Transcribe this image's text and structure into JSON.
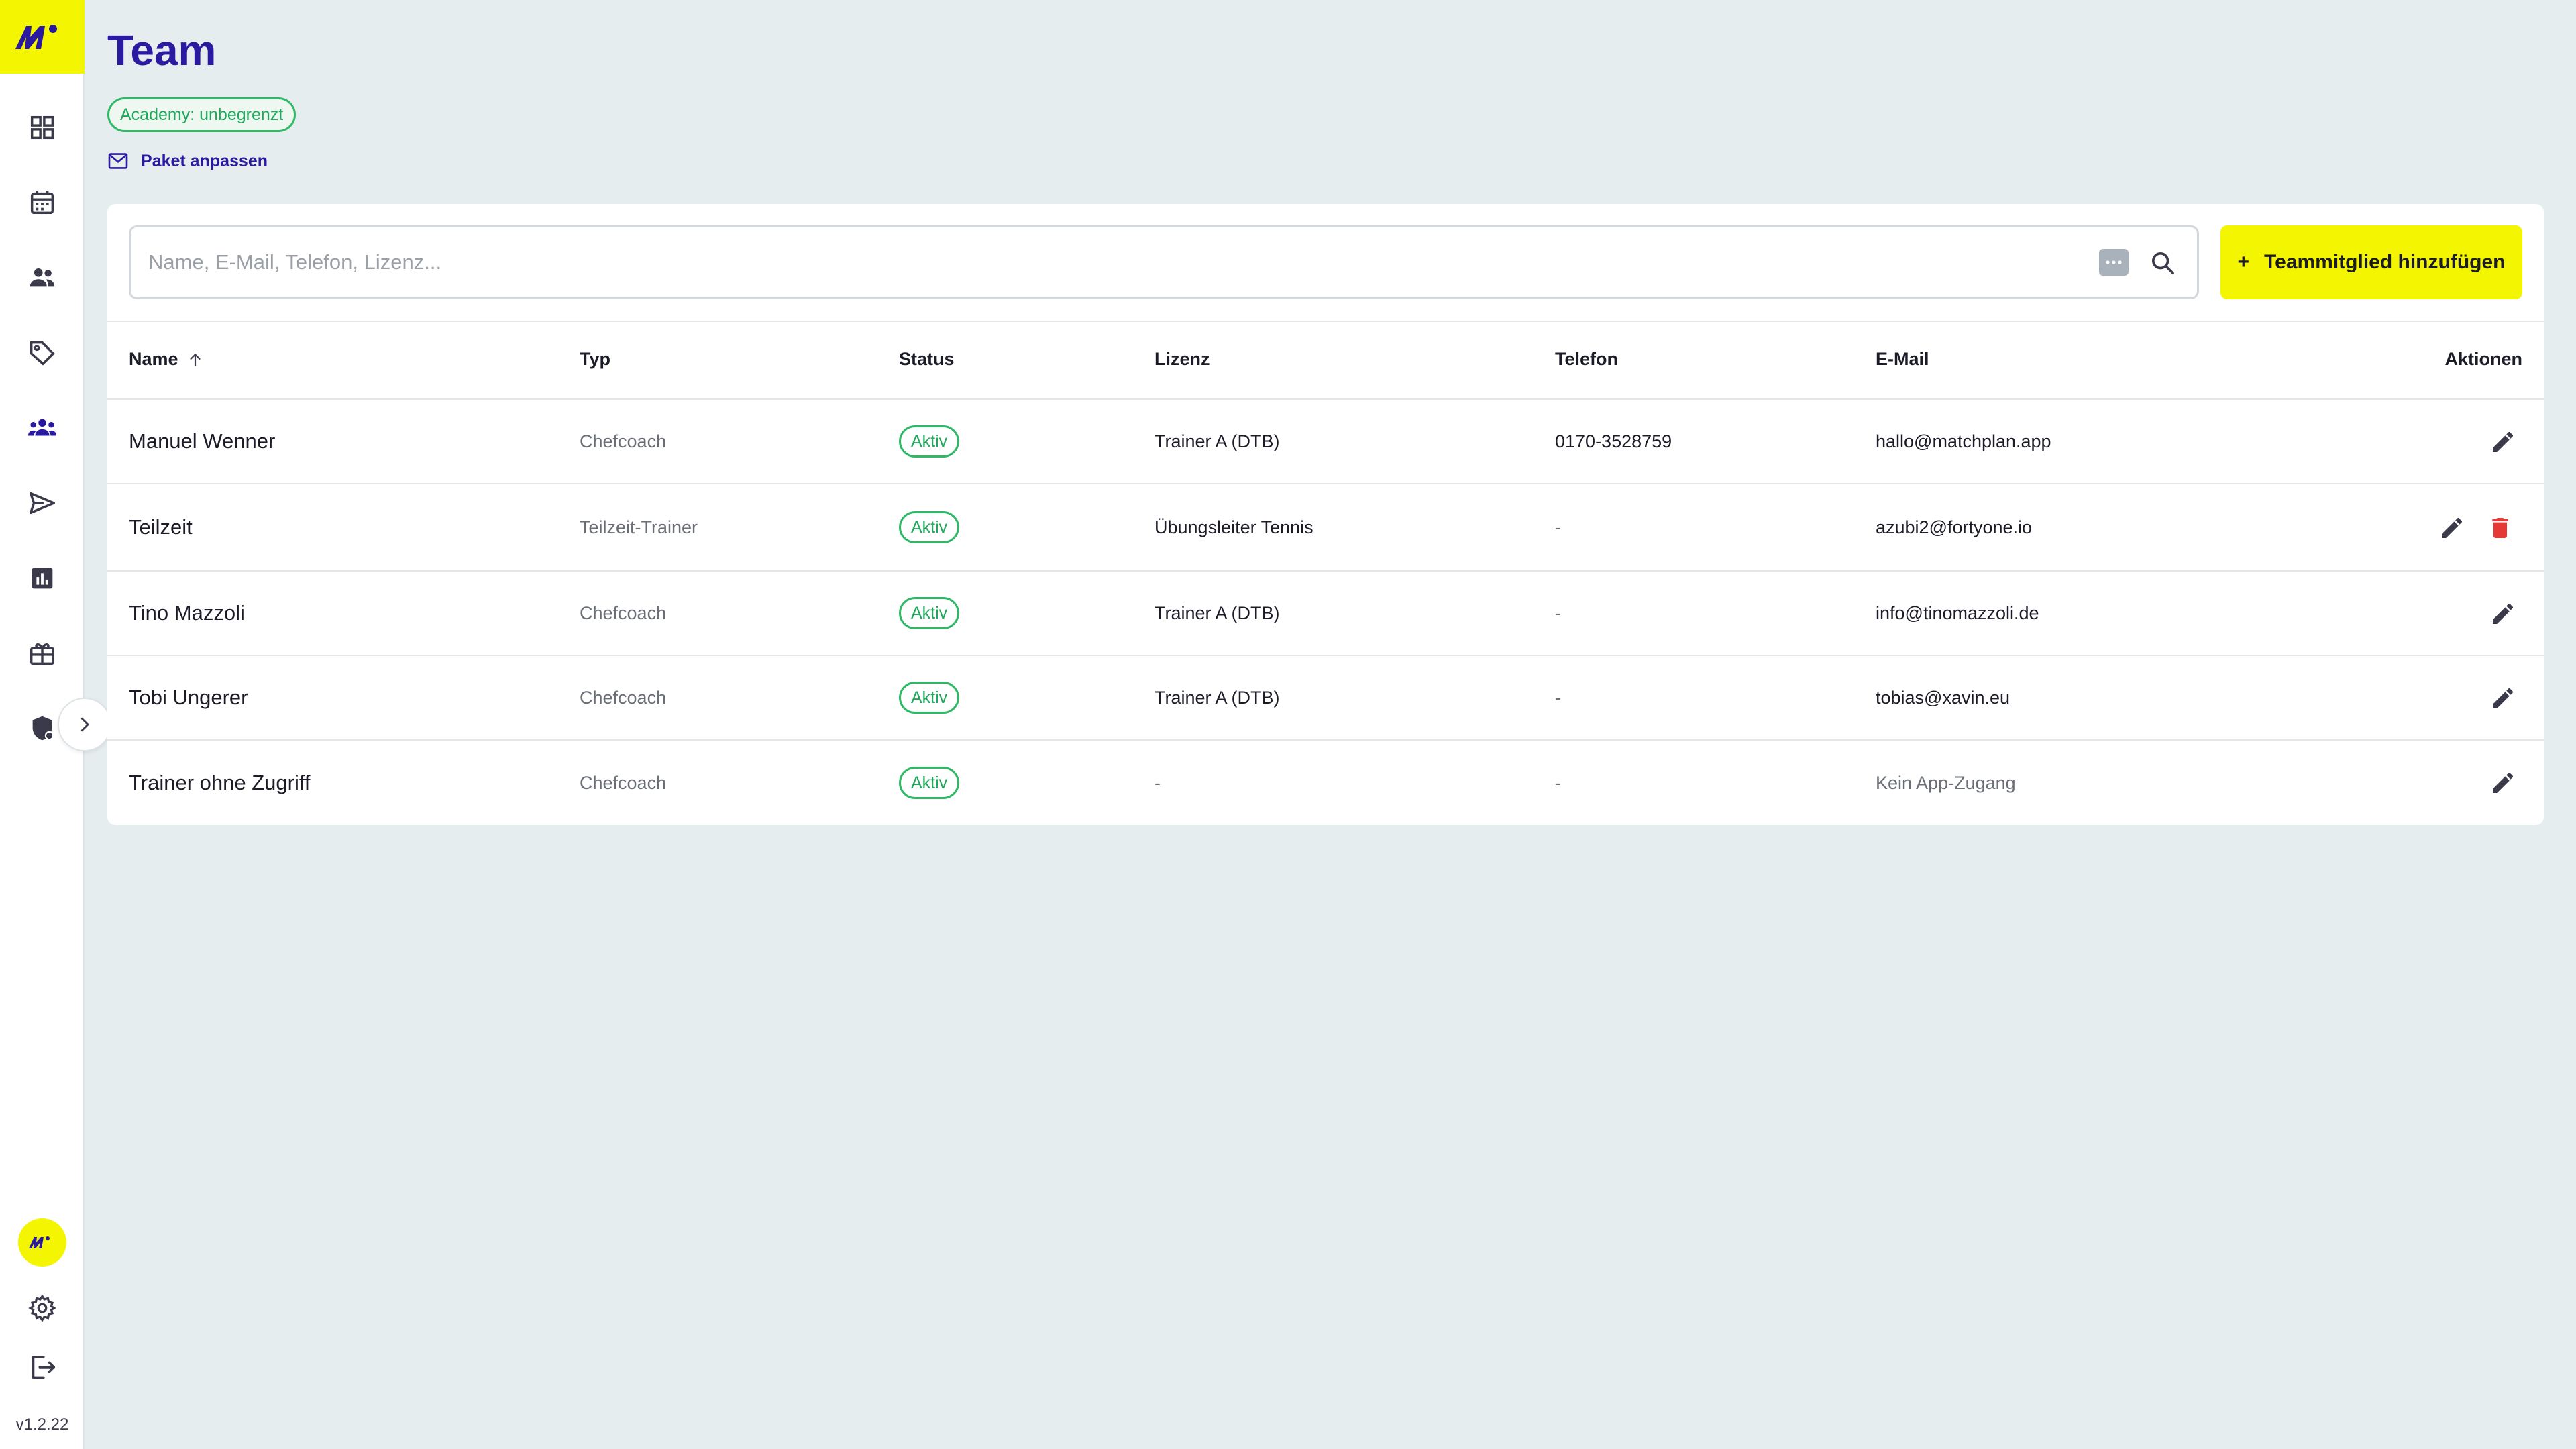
{
  "app": {
    "version": "v1.2.22",
    "brand_color": "#f4f500",
    "accent_color": "#2a1aa0",
    "status_color": "#2fb866"
  },
  "sidebar": {
    "items": [
      {
        "icon": "dashboard-icon"
      },
      {
        "icon": "calendar-icon"
      },
      {
        "icon": "people-icon"
      },
      {
        "icon": "tag-icon"
      },
      {
        "icon": "team-icon",
        "active": true
      },
      {
        "icon": "send-icon"
      },
      {
        "icon": "chart-icon"
      },
      {
        "icon": "gift-icon"
      },
      {
        "icon": "shield-icon"
      }
    ],
    "bottom": [
      "avatar",
      "settings-icon",
      "logout-icon"
    ]
  },
  "header": {
    "title": "Team",
    "badge": "Academy: unbegrenzt",
    "paket_link": "Paket anpassen"
  },
  "search": {
    "placeholder": "Name, E-Mail, Telefon, Lizenz...",
    "value": ""
  },
  "add_button": {
    "plus": "+",
    "label": "Teammitglied hinzufügen"
  },
  "table": {
    "columns": {
      "name": "Name",
      "typ": "Typ",
      "status": "Status",
      "lizenz": "Lizenz",
      "telefon": "Telefon",
      "email": "E-Mail",
      "aktionen": "Aktionen"
    },
    "rows": [
      {
        "name": "Manuel Wenner",
        "typ": "Chefcoach",
        "status": "Aktiv",
        "lizenz": "Trainer A (DTB)",
        "telefon": "0170-3528759",
        "email": "hallo@matchplan.app",
        "delete": false
      },
      {
        "name": "Teilzeit",
        "typ": "Teilzeit-Trainer",
        "status": "Aktiv",
        "lizenz": "Übungsleiter Tennis",
        "telefon": "-",
        "email": "azubi2@fortyone.io",
        "delete": true
      },
      {
        "name": "Tino Mazzoli",
        "typ": "Chefcoach",
        "status": "Aktiv",
        "lizenz": "Trainer A (DTB)",
        "telefon": "-",
        "email": "info@tinomazzoli.de",
        "delete": false
      },
      {
        "name": "Tobi Ungerer",
        "typ": "Chefcoach",
        "status": "Aktiv",
        "lizenz": "Trainer A (DTB)",
        "telefon": "-",
        "email": "tobias@xavin.eu",
        "delete": false
      },
      {
        "name": "Trainer ohne Zugriff",
        "typ": "Chefcoach",
        "status": "Aktiv",
        "lizenz": "-",
        "telefon": "-",
        "email": "Kein App-Zugang",
        "delete": false
      }
    ]
  }
}
